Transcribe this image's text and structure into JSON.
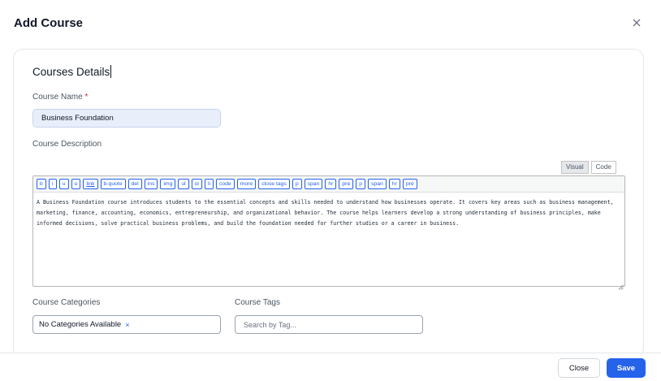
{
  "modal": {
    "title": "Add Course",
    "close_icon": "close-icon"
  },
  "section": {
    "title": "Courses Details"
  },
  "course_name": {
    "label": "Course Name",
    "required_mark": "*",
    "value": "Business Foundation"
  },
  "course_description": {
    "label": "Course Description",
    "modes": [
      "Visual",
      "Code"
    ],
    "active_mode": "Visual",
    "toolbar": [
      "b",
      "i",
      "u",
      "u",
      "link",
      "b-quote",
      "del",
      "ins",
      "img",
      "ul",
      "ol",
      "li",
      "code",
      "more",
      "close tags",
      "p",
      "span",
      "hr",
      "pre",
      "p",
      "span",
      "hr",
      "pre"
    ],
    "text": "A Business Foundation course introduces students to the essential concepts and skills needed to understand how businesses operate. It covers key areas such as business management, marketing, finance, accounting, economics, entrepreneurship, and organizational behavior. The course helps learners develop a strong understanding of business principles, make informed decisions, solve practical business problems, and build the foundation needed for further studies or a career in business."
  },
  "course_categories": {
    "label": "Course Categories",
    "chip": "No Categories Available",
    "chip_remove": "×"
  },
  "course_tags": {
    "label": "Course Tags",
    "placeholder": "Search by Tag..."
  },
  "footer": {
    "close_label": "Close",
    "save_label": "Save"
  },
  "colors": {
    "primary": "#2563eb",
    "required": "#dc2626",
    "input_fill": "#e8effb"
  }
}
